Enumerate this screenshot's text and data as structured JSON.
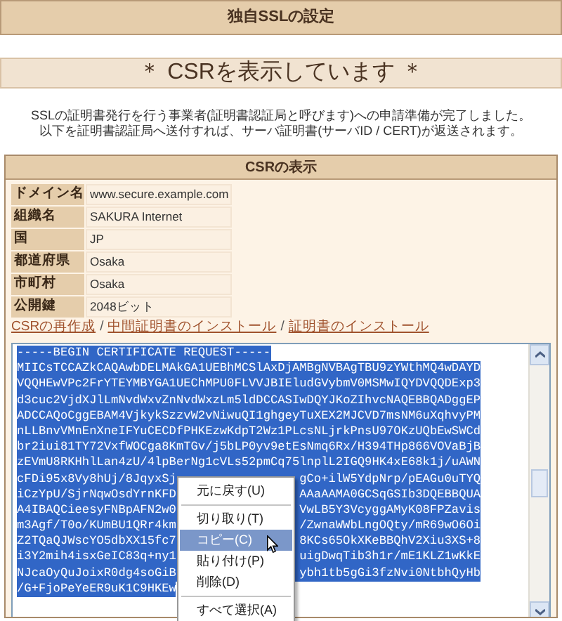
{
  "header": {
    "title": "独自SSLの設定"
  },
  "banner": {
    "title": "＊ CSRを表示しています ＊"
  },
  "intro": [
    "SSLの証明書発行を行う事業者(証明書認証局と呼びます)への申請準備が完了しました。",
    "以下を証明書認証局へ送付すれば、サーバ証明書(サーバID / CERT)が返送されます。"
  ],
  "csr_panel": {
    "title": "CSRの表示",
    "fields": [
      {
        "label": "ドメイン名",
        "value": "www.secure.example.com"
      },
      {
        "label": "組織名",
        "value": "SAKURA Internet"
      },
      {
        "label": "国",
        "value": "JP"
      },
      {
        "label": "都道府県",
        "value": "Osaka"
      },
      {
        "label": "市町村",
        "value": "Osaka"
      },
      {
        "label": "公開鍵",
        "value": "2048ビット"
      }
    ],
    "links": [
      "CSRの再作成",
      "中間証明書のインストール",
      "証明書のインストール"
    ],
    "separator": "/",
    "csr_lines": [
      {
        "left": "-----BEGIN CERTIFICATE REQUEST-----"
      },
      {
        "left": "MIICsTCCAZkCAQAwbDELMAkGA1UEBhMCSlAxDjAMBgNVBAgTBU9zYWthMQ4wDAYD"
      },
      {
        "left": "VQQHEwVPc2FrYTEYMBYGA1UEChMPU0FLVVJBIEludGVybmV0MSMwIQYDVQQDExp3"
      },
      {
        "left": "d3cuc2VjdXJlLmNvdWxvZnNvdWxzLm5ldDCCASIwDQYJKoZIhvcNAQEBBQADggEP"
      },
      {
        "left": "ADCCAQoCggEBAM4VjkykSzzvW2vNiwuQI1ghgeyTuXEX2MJCVD7msNM6uXqhvyPM"
      },
      {
        "left": "nLLBnvVMnEnXneIFYuCECDfPHKEzwKdpT2Wz1PLcsNLjrkPnsU97OKzUQbEwSWCd"
      },
      {
        "left": "br2iui81TY72VxfWOCga8KmTGv/j5bLP0yv9etEsNmq6Rx/H394THp866VOVaBjB"
      },
      {
        "left": "zEVmU8RKHhlLan4zU/4lpBerNg1cVLs52pmCq75lnplL2IGQ9HK4xE68k1j/uAWN"
      },
      {
        "left": "cFDi95x8Vy8hUj/8JqyxSj",
        "right": "gCo+ilW5YdpNrp/pEAGu0uTYQ"
      },
      {
        "left": "iCzYpU/SjrNqwOsdYrnKFD",
        "right": "AAaAAMA0GCSqGSIb3DQEBBQUA"
      },
      {
        "left": "A4IBAQCieesyFNBpAFN2w0",
        "right": "VwLB5Y3VcyggAMyK08FPZavis"
      },
      {
        "left": "m3Agf/T0o/KUmBU1QRr4km",
        "right": "/ZwnaWWbLngOQty/mR69wO6Oi"
      },
      {
        "left": "Z2TQaQJWscYO5dbXX15fc7",
        "right": "8KCs65OkXKeBBQhV2Xiu3XS+8"
      },
      {
        "left": "i3Y2mih4isxGeIC83q+ny1",
        "right": "uigDwqTib3h1r/mE1KLZ1wKkE"
      },
      {
        "left": "NJcaOyQuJoixR0dg4soGiB",
        "right": "ybh1tb5gGi3fzNvi0NtbhQyHb"
      },
      {
        "left": "/G+FjoPeYeER9uK1C9HKEw"
      }
    ]
  },
  "context_menu": {
    "items": [
      {
        "label": "元に戻す(U)",
        "selected": false,
        "divider_after": true
      },
      {
        "label": "切り取り(T)",
        "selected": false,
        "divider_after": false
      },
      {
        "label": "コピー(C)",
        "selected": true,
        "divider_after": false
      },
      {
        "label": "貼り付け(P)",
        "selected": false,
        "divider_after": false
      },
      {
        "label": "削除(D)",
        "selected": false,
        "divider_after": true
      },
      {
        "label": "すべて選択(A)",
        "selected": false,
        "divider_after": false
      }
    ]
  }
}
